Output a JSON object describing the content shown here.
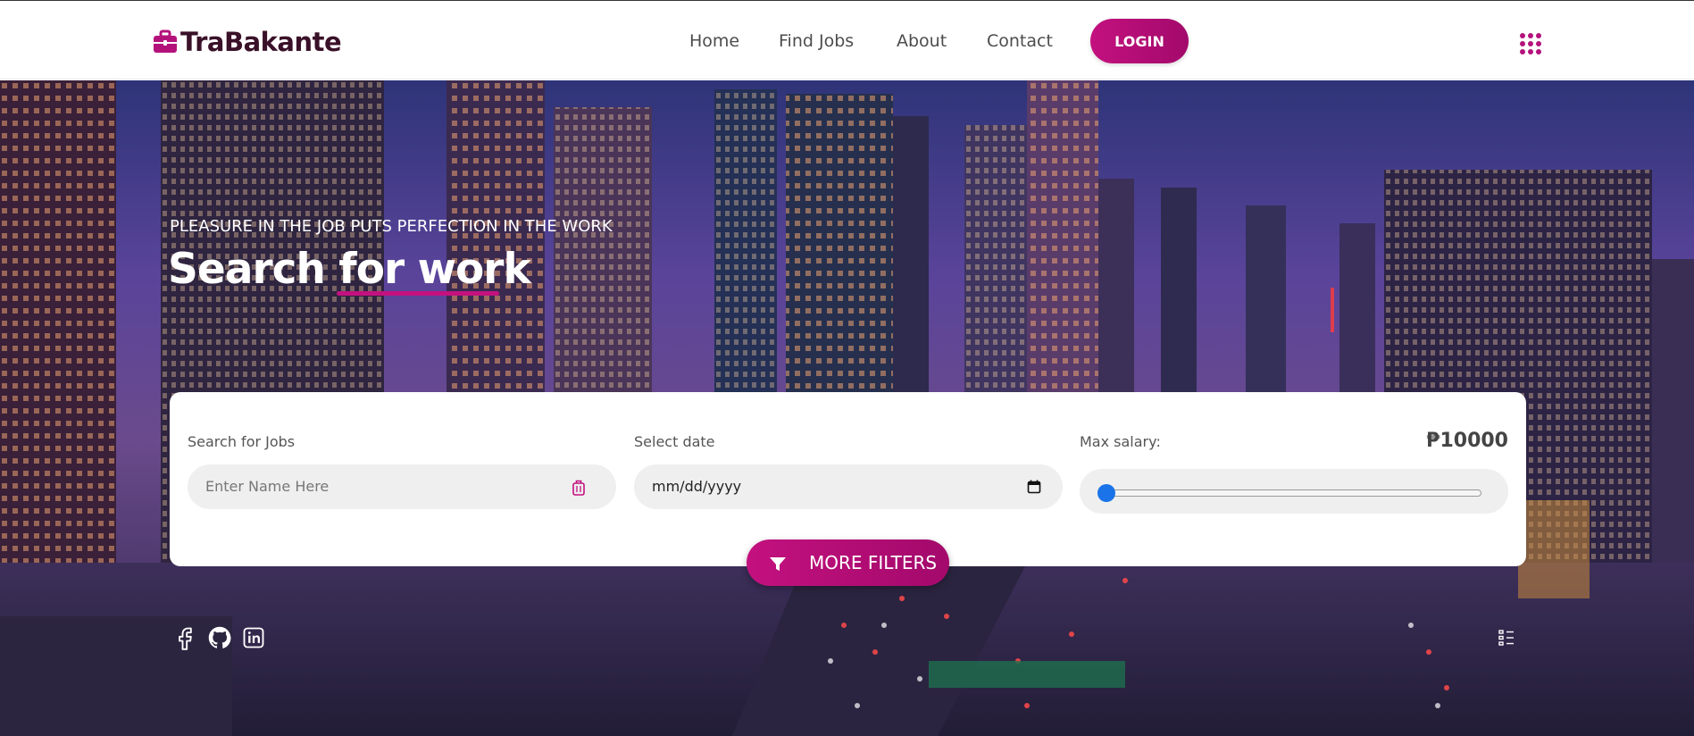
{
  "brand": {
    "name": "TraBakante",
    "accent_color": "#c3117f",
    "logo_icon": "briefcase-icon"
  },
  "nav": {
    "items": [
      {
        "label": "Home"
      },
      {
        "label": "Find Jobs"
      },
      {
        "label": "About"
      },
      {
        "label": "Contact"
      }
    ],
    "login_label": "LOGIN",
    "menu_icon": "grid-menu-icon"
  },
  "hero": {
    "tagline": "PLEASURE IN THE JOB PUTS PERFECTION IN THE WORK",
    "headline": "Search for work"
  },
  "search": {
    "jobs_label": "Search for Jobs",
    "jobs_placeholder": "Enter Name Here",
    "jobs_icon": "luggage-icon",
    "date_label": "Select date",
    "date_value": "mm/dd/yyyy",
    "date_icon": "calendar-icon",
    "salary_label": "Max salary:",
    "salary_value": "₱10000",
    "salary_slider_fraction": 0.0,
    "more_filters_label": "MORE FILTERS",
    "more_filters_icon": "filter-icon"
  },
  "social": {
    "icons": [
      "facebook-icon",
      "github-icon",
      "linkedin-icon"
    ],
    "side_icon": "list-icon"
  }
}
